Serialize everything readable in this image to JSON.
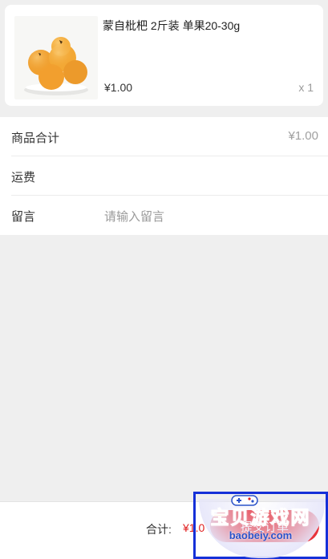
{
  "product": {
    "name": "蒙自枇杷 2斤装 单果20-30g",
    "price": "¥1.00",
    "quantity": "x 1",
    "image_icon": "loquat-fruit-image"
  },
  "summary": {
    "subtotal_label": "商品合计",
    "subtotal_value": "¥1.00",
    "shipping_label": "运费",
    "shipping_value": "",
    "message_label": "留言",
    "message_placeholder": "请输入留言"
  },
  "footer": {
    "total_label": "合计:",
    "total_amount": "¥1.0",
    "submit_label": "提交订单"
  },
  "watermark": {
    "title": "宝贝游戏网",
    "domain": "baobeiy.com",
    "icon": "gamepad-icon"
  },
  "colors": {
    "accent": "#e8323a",
    "price_red": "#e02020",
    "page_bg": "#efefef",
    "watermark_border": "#1530d8",
    "watermark_orange": "#f2a21d"
  }
}
